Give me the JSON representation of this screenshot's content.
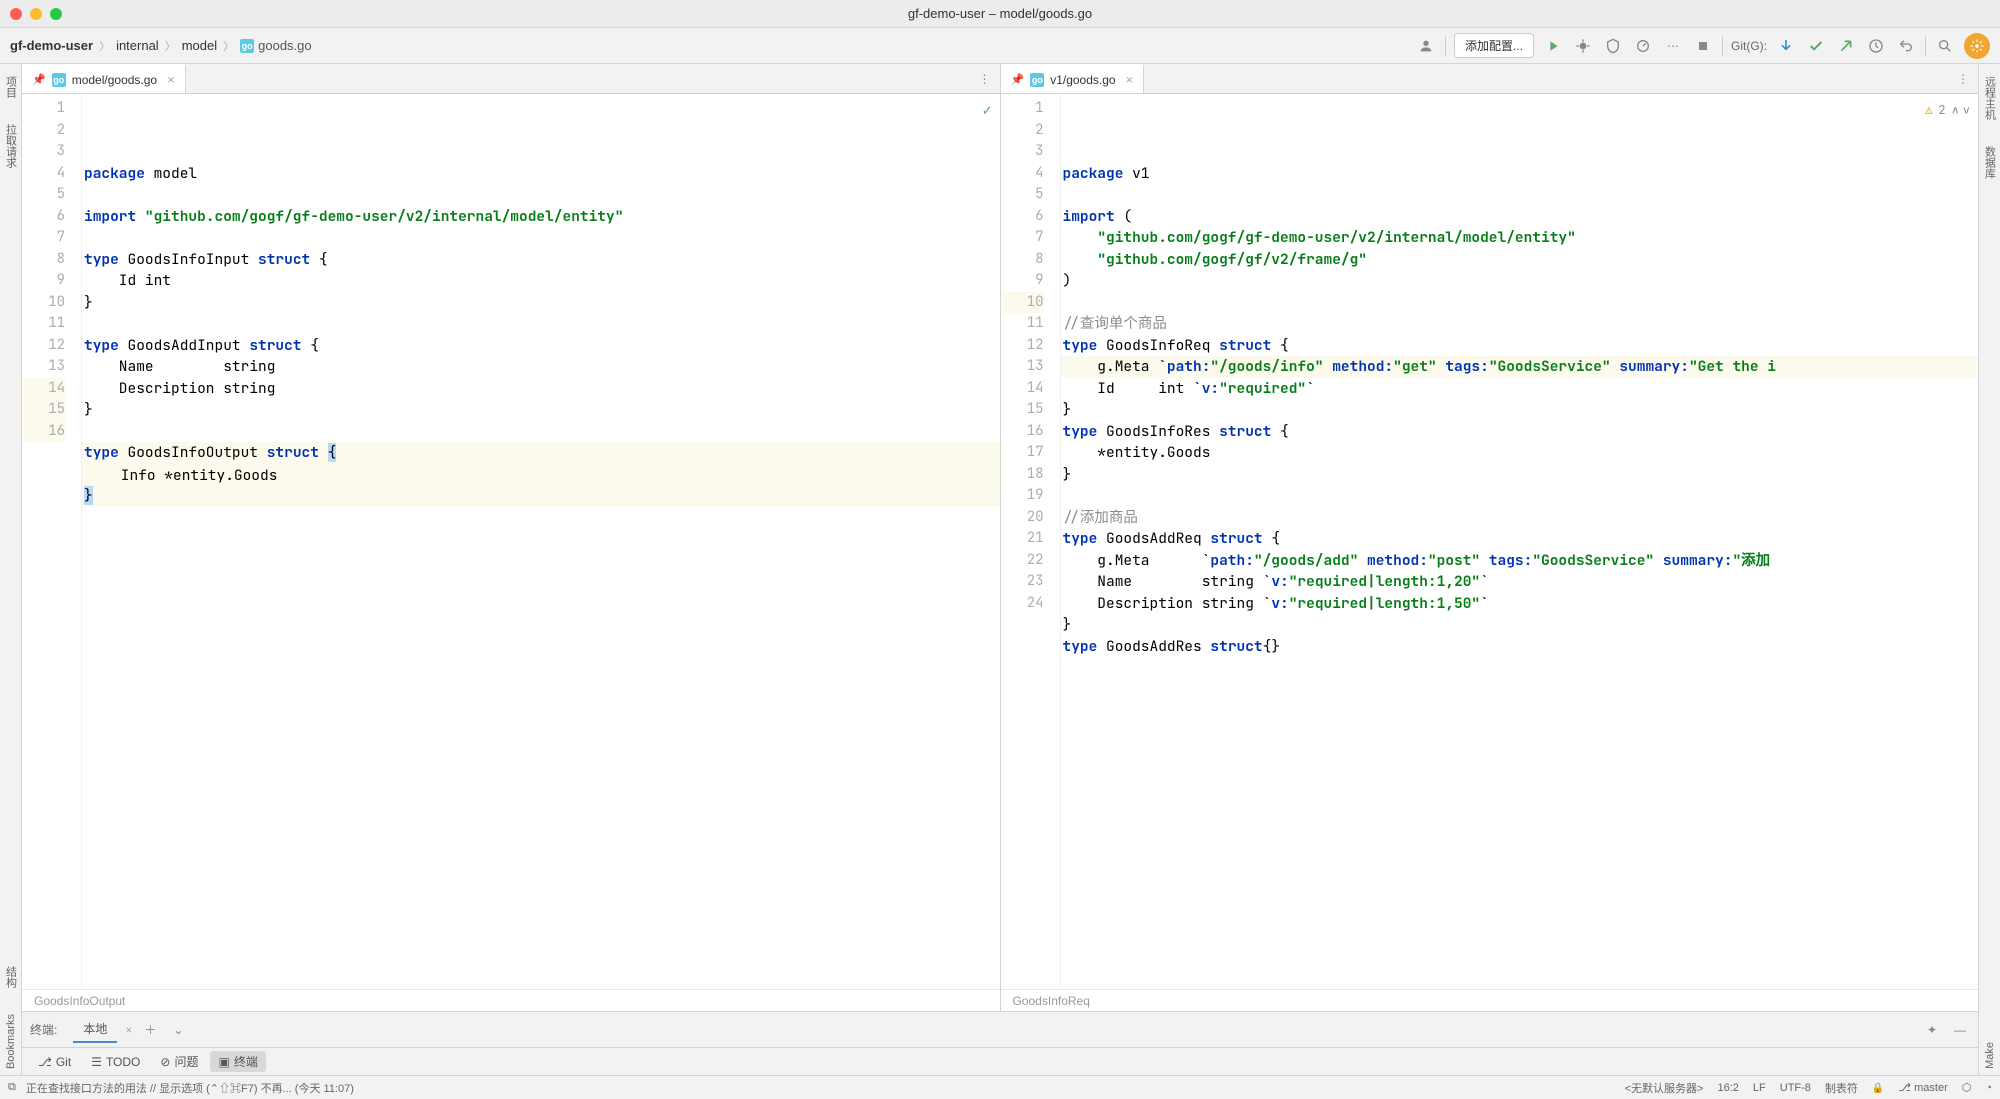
{
  "window": {
    "title": "gf-demo-user – model/goods.go"
  },
  "breadcrumbs": {
    "project": "gf-demo-user",
    "folder1": "internal",
    "folder2": "model",
    "file": "goods.go"
  },
  "toolbar": {
    "run_config": "添加配置...",
    "git_label": "Git(G):"
  },
  "toolwindows": {
    "left": [
      "项目",
      "拉取请求",
      "结构",
      "Bookmarks"
    ],
    "right": [
      "远程主机",
      "数据库",
      "Make"
    ]
  },
  "editor_left": {
    "tab": "model/goods.go",
    "breadcrumb": "GoodsInfoOutput",
    "code": [
      {
        "n": 1,
        "tokens": [
          [
            "kw",
            "package"
          ],
          [
            "",
            " model"
          ]
        ]
      },
      {
        "n": 2,
        "tokens": []
      },
      {
        "n": 3,
        "tokens": [
          [
            "kw",
            "import"
          ],
          [
            "",
            " "
          ],
          [
            "str",
            "\"github.com/gogf/gf-demo-user/v2/internal/model/entity\""
          ]
        ]
      },
      {
        "n": 4,
        "tokens": []
      },
      {
        "n": 5,
        "tokens": [
          [
            "kw",
            "type"
          ],
          [
            "",
            " GoodsInfoInput "
          ],
          [
            "kw",
            "struct"
          ],
          [
            "",
            " {"
          ]
        ]
      },
      {
        "n": 6,
        "tokens": [
          [
            "",
            "    Id int"
          ]
        ]
      },
      {
        "n": 7,
        "tokens": [
          [
            "",
            "}"
          ]
        ]
      },
      {
        "n": 8,
        "tokens": []
      },
      {
        "n": 9,
        "tokens": [
          [
            "kw",
            "type"
          ],
          [
            "",
            " GoodsAddInput "
          ],
          [
            "kw",
            "struct"
          ],
          [
            "",
            " {"
          ]
        ]
      },
      {
        "n": 10,
        "tokens": [
          [
            "",
            "    Name        string"
          ]
        ]
      },
      {
        "n": 11,
        "tokens": [
          [
            "",
            "    Description string"
          ]
        ]
      },
      {
        "n": 12,
        "tokens": [
          [
            "",
            "}"
          ]
        ]
      },
      {
        "n": 13,
        "tokens": []
      },
      {
        "n": 14,
        "hl": true,
        "tokens": [
          [
            "kw",
            "type"
          ],
          [
            "",
            " GoodsInfoOutput "
          ],
          [
            "kw",
            "struct"
          ],
          [
            "",
            " "
          ],
          [
            "sel-brace",
            "{"
          ]
        ]
      },
      {
        "n": 15,
        "hl": true,
        "bulb": true,
        "tokens": [
          [
            "",
            "    Info *entity.Goods"
          ]
        ]
      },
      {
        "n": 16,
        "hl": true,
        "tokens": [
          [
            "sel-brace",
            "}"
          ]
        ]
      }
    ]
  },
  "editor_right": {
    "tab": "v1/goods.go",
    "breadcrumb": "GoodsInfoReq",
    "warnings": "2",
    "code": [
      {
        "n": 1,
        "tokens": [
          [
            "kw",
            "package"
          ],
          [
            "",
            " v1"
          ]
        ]
      },
      {
        "n": 2,
        "tokens": []
      },
      {
        "n": 3,
        "tokens": [
          [
            "kw",
            "import"
          ],
          [
            "",
            " ("
          ]
        ]
      },
      {
        "n": 4,
        "tokens": [
          [
            "",
            "    "
          ],
          [
            "str",
            "\"github.com/gogf/gf-demo-user/v2/internal/model/entity\""
          ]
        ]
      },
      {
        "n": 5,
        "tokens": [
          [
            "",
            "    "
          ],
          [
            "str",
            "\"github.com/gogf/gf/v2/frame/g\""
          ]
        ]
      },
      {
        "n": 6,
        "tokens": [
          [
            "",
            ")"
          ]
        ]
      },
      {
        "n": 7,
        "tokens": []
      },
      {
        "n": 8,
        "tokens": [
          [
            "cmt",
            "//查询单个商品"
          ]
        ]
      },
      {
        "n": 9,
        "tokens": [
          [
            "kw",
            "type"
          ],
          [
            "",
            " GoodsInfoReq "
          ],
          [
            "kw",
            "struct"
          ],
          [
            "",
            " {"
          ]
        ]
      },
      {
        "n": 10,
        "hl": true,
        "tokens": [
          [
            "",
            "    g.Meta `"
          ],
          [
            "tag",
            "path:"
          ],
          [
            "tagv",
            "\"/goods/info\""
          ],
          [
            "",
            " "
          ],
          [
            "tag",
            "method:"
          ],
          [
            "tagv",
            "\"get\""
          ],
          [
            "",
            " "
          ],
          [
            "tag",
            "tags:"
          ],
          [
            "tagv",
            "\"GoodsService\""
          ],
          [
            "",
            " "
          ],
          [
            "tag",
            "summary:"
          ],
          [
            "tagv",
            "\"Get the i"
          ]
        ]
      },
      {
        "n": 11,
        "tokens": [
          [
            "",
            "    Id     int `"
          ],
          [
            "tag",
            "v:"
          ],
          [
            "tagv",
            "\"required\""
          ],
          [
            "",
            "`"
          ]
        ]
      },
      {
        "n": 12,
        "tokens": [
          [
            "",
            "}"
          ]
        ]
      },
      {
        "n": 13,
        "tokens": [
          [
            "kw",
            "type"
          ],
          [
            "",
            " GoodsInfoRes "
          ],
          [
            "kw",
            "struct"
          ],
          [
            "",
            " {"
          ]
        ]
      },
      {
        "n": 14,
        "tokens": [
          [
            "",
            "    *entity.Goods"
          ]
        ]
      },
      {
        "n": 15,
        "tokens": [
          [
            "",
            "}"
          ]
        ]
      },
      {
        "n": 16,
        "tokens": []
      },
      {
        "n": 17,
        "tokens": [
          [
            "cmt",
            "//添加商品"
          ]
        ]
      },
      {
        "n": 18,
        "tokens": [
          [
            "kw",
            "type"
          ],
          [
            "",
            " GoodsAddReq "
          ],
          [
            "kw",
            "struct"
          ],
          [
            "",
            " {"
          ]
        ]
      },
      {
        "n": 19,
        "tokens": [
          [
            "",
            "    g.Meta      `"
          ],
          [
            "tag",
            "path:"
          ],
          [
            "tagv",
            "\"/goods/add\""
          ],
          [
            "",
            " "
          ],
          [
            "tag",
            "method:"
          ],
          [
            "tagv",
            "\"post\""
          ],
          [
            "",
            " "
          ],
          [
            "tag",
            "tags:"
          ],
          [
            "tagv",
            "\"GoodsService\""
          ],
          [
            "",
            " "
          ],
          [
            "tag",
            "summary:"
          ],
          [
            "tagv",
            "\"添加"
          ]
        ]
      },
      {
        "n": 20,
        "tokens": [
          [
            "",
            "    Name        string `"
          ],
          [
            "tag",
            "v:"
          ],
          [
            "tagv",
            "\"required|length:1,20\""
          ],
          [
            "",
            "`"
          ]
        ]
      },
      {
        "n": 21,
        "tokens": [
          [
            "",
            "    Description string `"
          ],
          [
            "tag",
            "v:"
          ],
          [
            "tagv",
            "\"required|length:1,50\""
          ],
          [
            "",
            "`"
          ]
        ]
      },
      {
        "n": 22,
        "tokens": [
          [
            "",
            "}"
          ]
        ]
      },
      {
        "n": 23,
        "tokens": [
          [
            "kw",
            "type"
          ],
          [
            "",
            " GoodsAddRes "
          ],
          [
            "kw",
            "struct"
          ],
          [
            "",
            "{}"
          ]
        ]
      },
      {
        "n": 24,
        "tokens": []
      }
    ]
  },
  "terminal": {
    "label": "终端:",
    "tab": "本地"
  },
  "bottom": {
    "git": "Git",
    "todo": "TODO",
    "problems": "问题",
    "terminal": "终端"
  },
  "status": {
    "left": "正在查找接口方法的用法 // 显示选项 (⌃⇧⌘F7)   不再... (今天 11:07)",
    "server": "<无默认服务器>",
    "pos": "16:2",
    "le": "LF",
    "enc": "UTF-8",
    "indent": "制表符",
    "branch": "master"
  }
}
